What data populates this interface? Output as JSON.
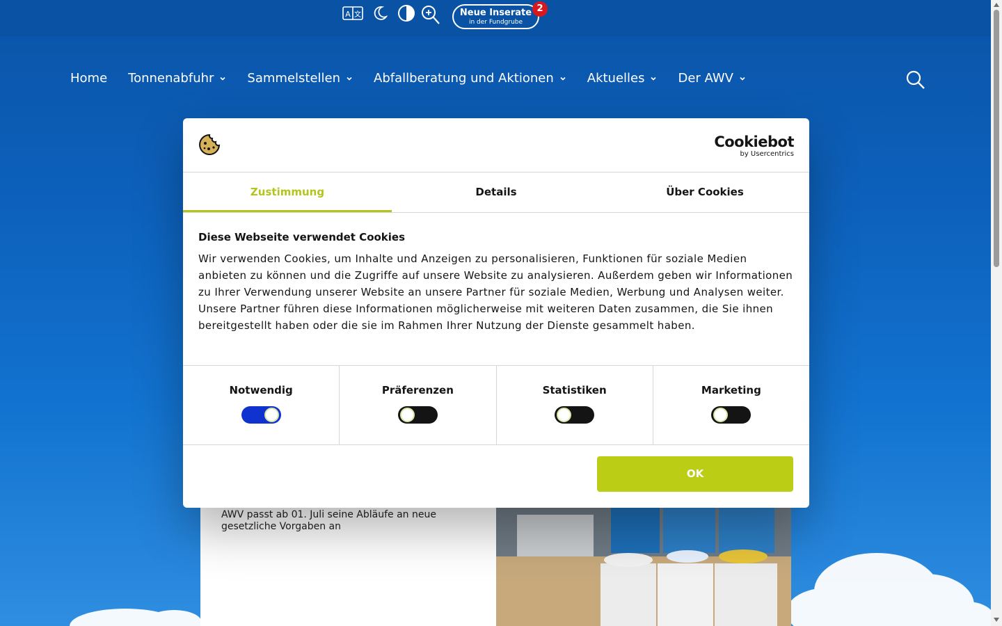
{
  "topbar": {
    "icons": [
      "translate-icon",
      "moon-icon",
      "contrast-icon",
      "zoom-in-icon"
    ],
    "fundgrube": {
      "title": "Neue Inserate",
      "subtitle": "in der Fundgrube",
      "badge": "2"
    }
  },
  "nav": {
    "items": [
      {
        "label": "Home",
        "has_submenu": false
      },
      {
        "label": "Tonnenabfuhr",
        "has_submenu": true
      },
      {
        "label": "Sammelstellen",
        "has_submenu": true
      },
      {
        "label": "Abfallberatung und Aktionen",
        "has_submenu": true
      },
      {
        "label": "Aktuelles",
        "has_submenu": true
      },
      {
        "label": "Der AWV",
        "has_submenu": true
      }
    ],
    "search_icon": "search-icon"
  },
  "background": {
    "news_card": {
      "text": "AWV passt ab 01. Juli seine Abläufe an neue gesetzliche Vorgaben an"
    }
  },
  "cookie_dialog": {
    "brand": {
      "name": "Cookiebot",
      "by": "by Usercentrics"
    },
    "tabs": [
      {
        "label": "Zustimmung",
        "active": true
      },
      {
        "label": "Details",
        "active": false
      },
      {
        "label": "Über Cookies",
        "active": false
      }
    ],
    "title": "Diese Webseite verwendet Cookies",
    "text": "Wir verwenden Cookies, um Inhalte und Anzeigen zu personalisieren, Funktionen für soziale Medien anbieten zu können und die Zugriffe auf unsere Website zu analysieren. Außerdem geben wir Informationen zu Ihrer Verwendung unserer Website an unsere Partner für soziale Medien, Werbung und Analysen weiter. Unsere Partner führen diese Informationen möglicherweise mit weiteren Daten zusammen, die Sie ihnen bereitgestellt haben oder die sie im Rahmen Ihrer Nutzung der Dienste gesammelt haben.",
    "toggles": [
      {
        "label": "Notwendig",
        "on": true
      },
      {
        "label": "Präferenzen",
        "on": false
      },
      {
        "label": "Statistiken",
        "on": false
      },
      {
        "label": "Marketing",
        "on": false
      }
    ],
    "ok_label": "OK"
  },
  "colors": {
    "page_blue": "#0a52a4",
    "accent_green": "#bccd15",
    "toggle_on": "#1032cf",
    "toggle_off": "#141414",
    "badge_red": "#d7191f"
  }
}
